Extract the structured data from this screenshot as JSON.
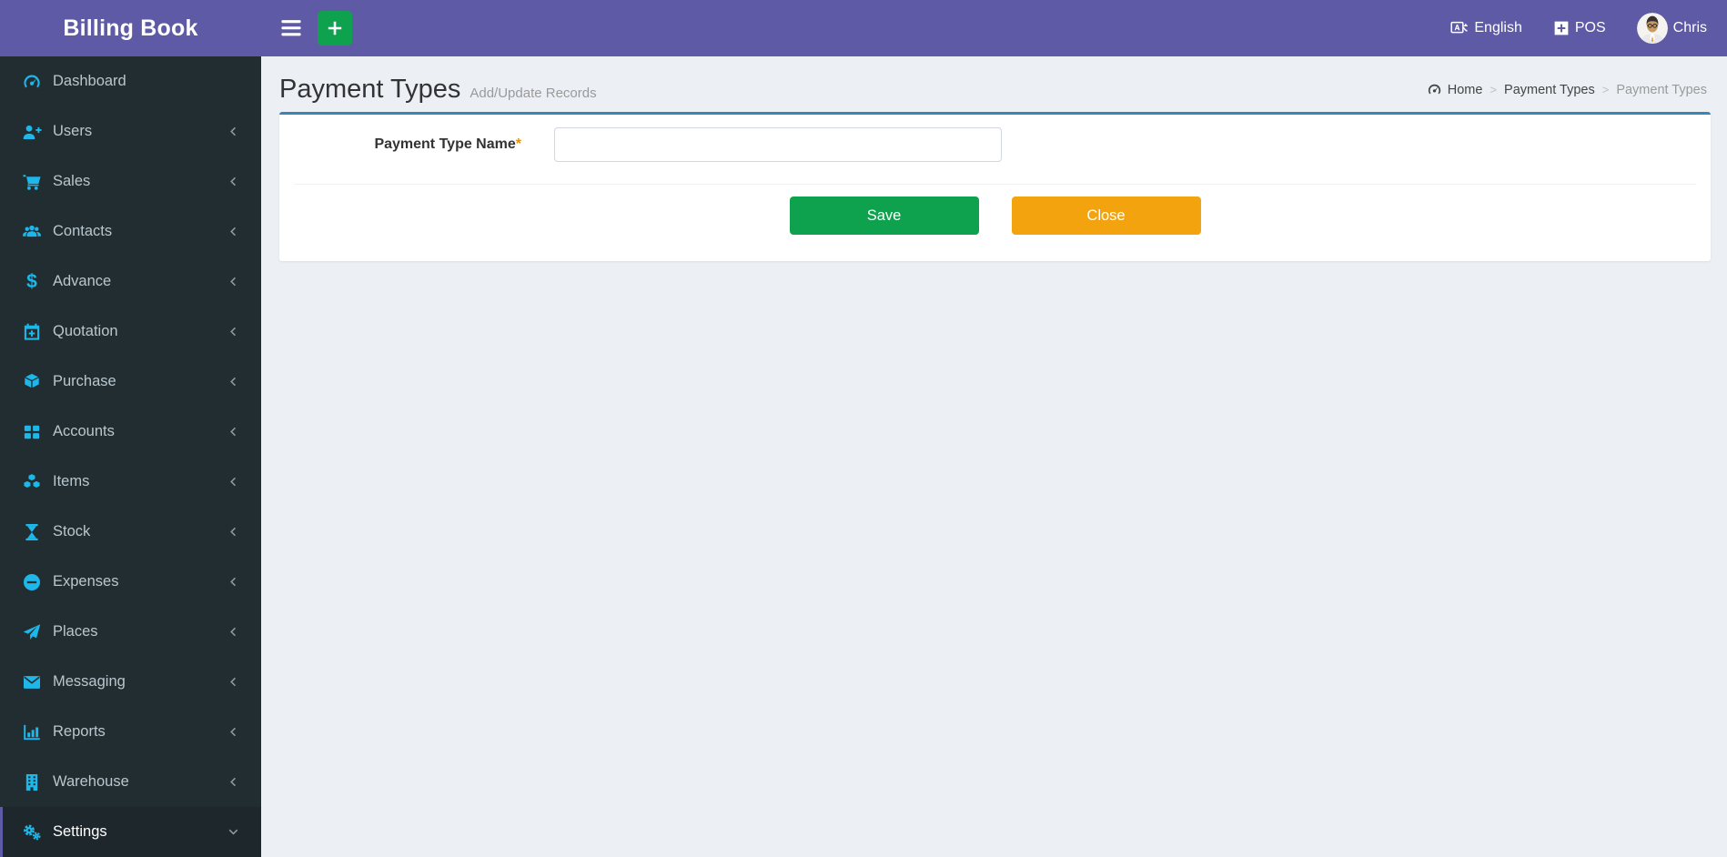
{
  "colors": {
    "header_purple": "#5e5aa5",
    "sidebar_bg": "#222d32",
    "sidebar_active_bg": "#1e282c",
    "sidebar_text": "#b8c7ce",
    "icon_cyan": "#1db7ea",
    "green": "#0ea24e",
    "orange": "#f3a30d",
    "card_top_border": "#3786b5",
    "content_bg": "#ecf0f5"
  },
  "header": {
    "brand": "Billing Book",
    "language_label": "English",
    "pos_label": "POS",
    "user_name": "Chris"
  },
  "sidebar": {
    "items": [
      {
        "label": "Dashboard",
        "icon": "gauge-icon",
        "arrow": "none"
      },
      {
        "label": "Users",
        "icon": "user-plus-icon",
        "arrow": "left"
      },
      {
        "label": "Sales",
        "icon": "cart-icon",
        "arrow": "left"
      },
      {
        "label": "Contacts",
        "icon": "users-icon",
        "arrow": "left"
      },
      {
        "label": "Advance",
        "icon": "dollar-icon",
        "arrow": "left"
      },
      {
        "label": "Quotation",
        "icon": "calendar-plus-icon",
        "arrow": "left"
      },
      {
        "label": "Purchase",
        "icon": "cube-icon",
        "arrow": "left"
      },
      {
        "label": "Accounts",
        "icon": "grid-icon",
        "arrow": "left"
      },
      {
        "label": "Items",
        "icon": "cubes-icon",
        "arrow": "left"
      },
      {
        "label": "Stock",
        "icon": "hourglass-icon",
        "arrow": "left"
      },
      {
        "label": "Expenses",
        "icon": "minus-circle-icon",
        "arrow": "left"
      },
      {
        "label": "Places",
        "icon": "paper-plane-icon",
        "arrow": "left"
      },
      {
        "label": "Messaging",
        "icon": "envelope-icon",
        "arrow": "left"
      },
      {
        "label": "Reports",
        "icon": "bar-chart-icon",
        "arrow": "left"
      },
      {
        "label": "Warehouse",
        "icon": "building-icon",
        "arrow": "left"
      },
      {
        "label": "Settings",
        "icon": "cogs-icon",
        "arrow": "down",
        "active": true
      }
    ]
  },
  "page": {
    "title": "Payment Types",
    "subtitle": "Add/Update Records",
    "breadcrumb": {
      "home": "Home",
      "level1": "Payment Types",
      "current": "Payment Types"
    }
  },
  "form": {
    "name_label": "Payment Type Name",
    "required_mark": "*",
    "input_value": "",
    "save_label": "Save",
    "close_label": "Close"
  }
}
